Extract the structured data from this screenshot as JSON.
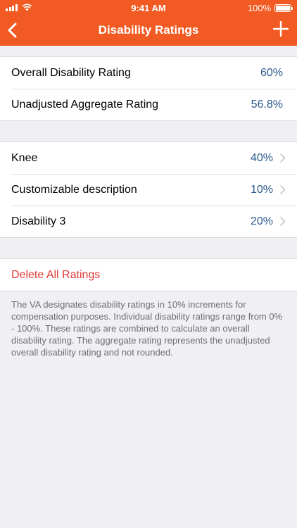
{
  "status_bar": {
    "time": "9:41 AM",
    "battery_text": "100%"
  },
  "nav": {
    "title": "Disability Ratings",
    "back_icon": "chevron-left-icon",
    "add_icon": "plus-icon"
  },
  "summary": [
    {
      "label": "Overall Disability Rating",
      "value": "60%"
    },
    {
      "label": "Unadjusted Aggregate Rating",
      "value": "56.8%"
    }
  ],
  "ratings": [
    {
      "label": "Knee",
      "value": "40%"
    },
    {
      "label": "Customizable description",
      "value": "10%"
    },
    {
      "label": "Disability 3",
      "value": "20%"
    }
  ],
  "actions": {
    "delete_label": "Delete All Ratings"
  },
  "footer_note": "The VA designates disability ratings in 10% increments for compensation purposes. Individual disability ratings range from 0% - 100%. These ratings are combined to calculate an overall disability rating. The aggregate rating represents the unadjusted overall disability rating and not rounded.",
  "colors": {
    "accent": "#f15a22",
    "value_text": "#2c5a8c",
    "destructive": "#e03a35",
    "background": "#efeff4"
  }
}
